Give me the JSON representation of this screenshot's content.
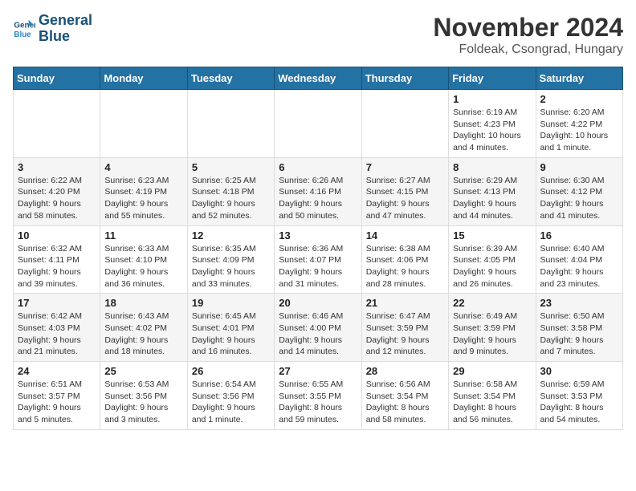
{
  "logo": {
    "line1": "General",
    "line2": "Blue"
  },
  "title": "November 2024",
  "location": "Foldeak, Csongrad, Hungary",
  "weekdays": [
    "Sunday",
    "Monday",
    "Tuesday",
    "Wednesday",
    "Thursday",
    "Friday",
    "Saturday"
  ],
  "weeks": [
    [
      {
        "day": "",
        "info": ""
      },
      {
        "day": "",
        "info": ""
      },
      {
        "day": "",
        "info": ""
      },
      {
        "day": "",
        "info": ""
      },
      {
        "day": "",
        "info": ""
      },
      {
        "day": "1",
        "info": "Sunrise: 6:19 AM\nSunset: 4:23 PM\nDaylight: 10 hours\nand 4 minutes."
      },
      {
        "day": "2",
        "info": "Sunrise: 6:20 AM\nSunset: 4:22 PM\nDaylight: 10 hours\nand 1 minute."
      }
    ],
    [
      {
        "day": "3",
        "info": "Sunrise: 6:22 AM\nSunset: 4:20 PM\nDaylight: 9 hours\nand 58 minutes."
      },
      {
        "day": "4",
        "info": "Sunrise: 6:23 AM\nSunset: 4:19 PM\nDaylight: 9 hours\nand 55 minutes."
      },
      {
        "day": "5",
        "info": "Sunrise: 6:25 AM\nSunset: 4:18 PM\nDaylight: 9 hours\nand 52 minutes."
      },
      {
        "day": "6",
        "info": "Sunrise: 6:26 AM\nSunset: 4:16 PM\nDaylight: 9 hours\nand 50 minutes."
      },
      {
        "day": "7",
        "info": "Sunrise: 6:27 AM\nSunset: 4:15 PM\nDaylight: 9 hours\nand 47 minutes."
      },
      {
        "day": "8",
        "info": "Sunrise: 6:29 AM\nSunset: 4:13 PM\nDaylight: 9 hours\nand 44 minutes."
      },
      {
        "day": "9",
        "info": "Sunrise: 6:30 AM\nSunset: 4:12 PM\nDaylight: 9 hours\nand 41 minutes."
      }
    ],
    [
      {
        "day": "10",
        "info": "Sunrise: 6:32 AM\nSunset: 4:11 PM\nDaylight: 9 hours\nand 39 minutes."
      },
      {
        "day": "11",
        "info": "Sunrise: 6:33 AM\nSunset: 4:10 PM\nDaylight: 9 hours\nand 36 minutes."
      },
      {
        "day": "12",
        "info": "Sunrise: 6:35 AM\nSunset: 4:09 PM\nDaylight: 9 hours\nand 33 minutes."
      },
      {
        "day": "13",
        "info": "Sunrise: 6:36 AM\nSunset: 4:07 PM\nDaylight: 9 hours\nand 31 minutes."
      },
      {
        "day": "14",
        "info": "Sunrise: 6:38 AM\nSunset: 4:06 PM\nDaylight: 9 hours\nand 28 minutes."
      },
      {
        "day": "15",
        "info": "Sunrise: 6:39 AM\nSunset: 4:05 PM\nDaylight: 9 hours\nand 26 minutes."
      },
      {
        "day": "16",
        "info": "Sunrise: 6:40 AM\nSunset: 4:04 PM\nDaylight: 9 hours\nand 23 minutes."
      }
    ],
    [
      {
        "day": "17",
        "info": "Sunrise: 6:42 AM\nSunset: 4:03 PM\nDaylight: 9 hours\nand 21 minutes."
      },
      {
        "day": "18",
        "info": "Sunrise: 6:43 AM\nSunset: 4:02 PM\nDaylight: 9 hours\nand 18 minutes."
      },
      {
        "day": "19",
        "info": "Sunrise: 6:45 AM\nSunset: 4:01 PM\nDaylight: 9 hours\nand 16 minutes."
      },
      {
        "day": "20",
        "info": "Sunrise: 6:46 AM\nSunset: 4:00 PM\nDaylight: 9 hours\nand 14 minutes."
      },
      {
        "day": "21",
        "info": "Sunrise: 6:47 AM\nSunset: 3:59 PM\nDaylight: 9 hours\nand 12 minutes."
      },
      {
        "day": "22",
        "info": "Sunrise: 6:49 AM\nSunset: 3:59 PM\nDaylight: 9 hours\nand 9 minutes."
      },
      {
        "day": "23",
        "info": "Sunrise: 6:50 AM\nSunset: 3:58 PM\nDaylight: 9 hours\nand 7 minutes."
      }
    ],
    [
      {
        "day": "24",
        "info": "Sunrise: 6:51 AM\nSunset: 3:57 PM\nDaylight: 9 hours\nand 5 minutes."
      },
      {
        "day": "25",
        "info": "Sunrise: 6:53 AM\nSunset: 3:56 PM\nDaylight: 9 hours\nand 3 minutes."
      },
      {
        "day": "26",
        "info": "Sunrise: 6:54 AM\nSunset: 3:56 PM\nDaylight: 9 hours\nand 1 minute."
      },
      {
        "day": "27",
        "info": "Sunrise: 6:55 AM\nSunset: 3:55 PM\nDaylight: 8 hours\nand 59 minutes."
      },
      {
        "day": "28",
        "info": "Sunrise: 6:56 AM\nSunset: 3:54 PM\nDaylight: 8 hours\nand 58 minutes."
      },
      {
        "day": "29",
        "info": "Sunrise: 6:58 AM\nSunset: 3:54 PM\nDaylight: 8 hours\nand 56 minutes."
      },
      {
        "day": "30",
        "info": "Sunrise: 6:59 AM\nSunset: 3:53 PM\nDaylight: 8 hours\nand 54 minutes."
      }
    ]
  ]
}
